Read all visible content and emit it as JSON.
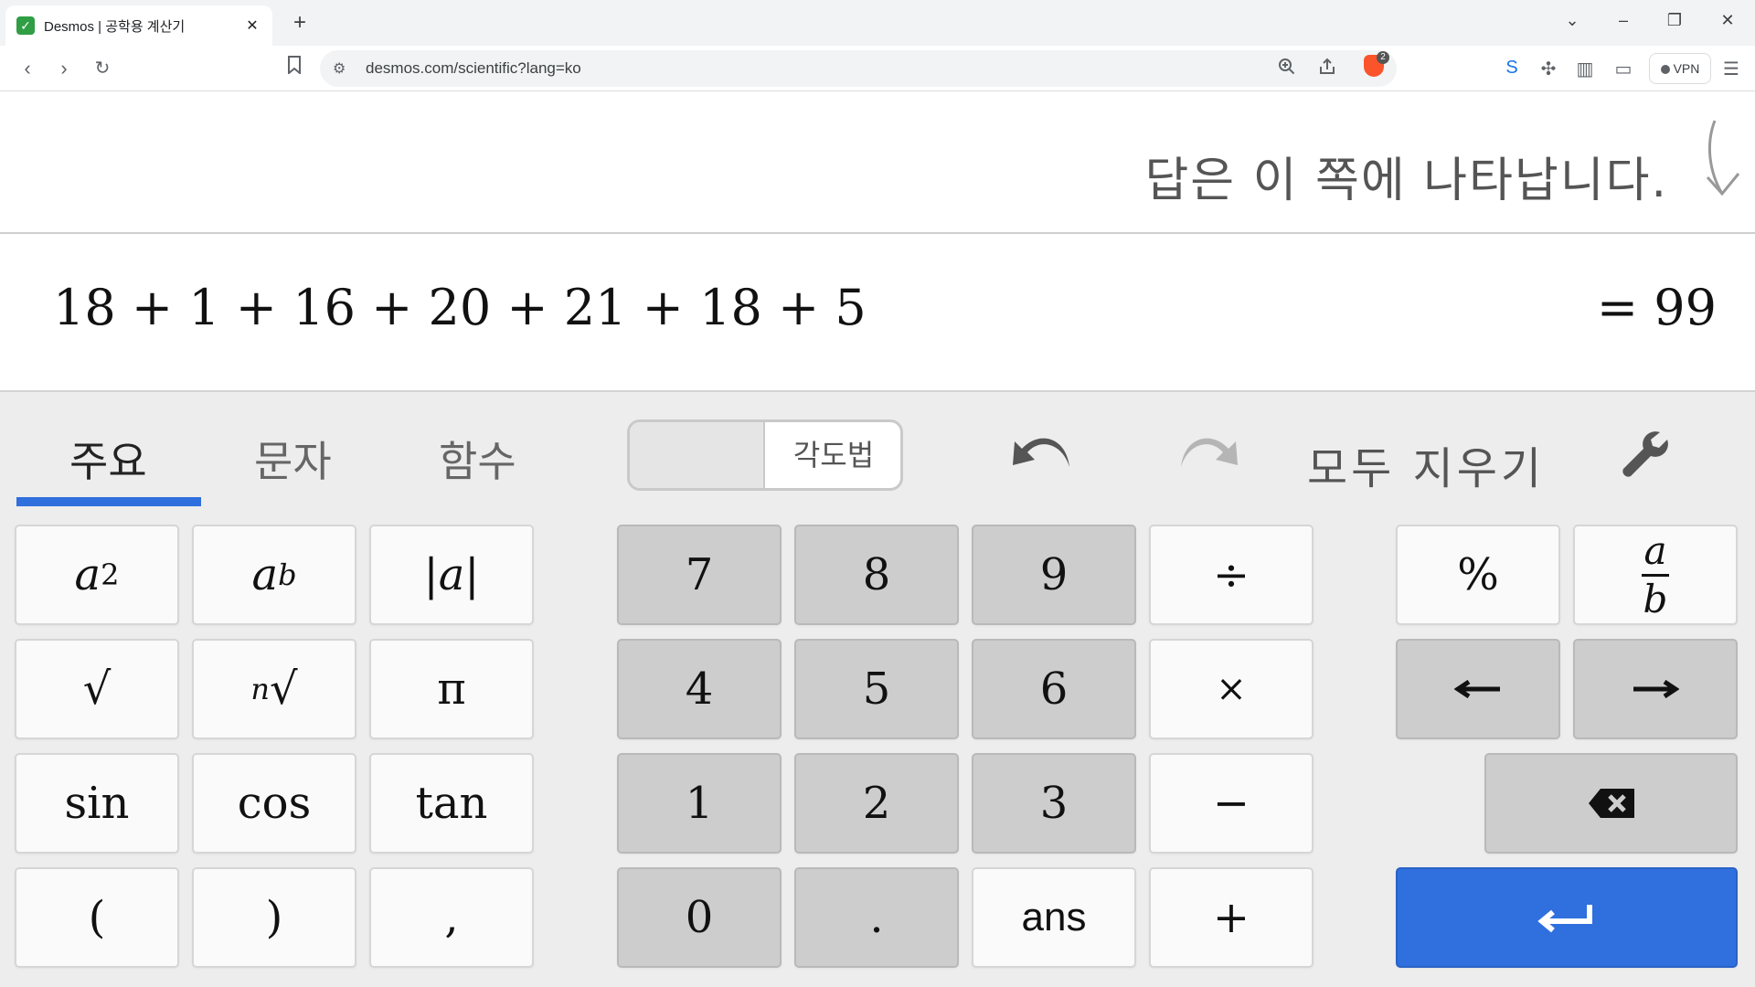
{
  "browser": {
    "tab_title": "Desmos | 공학용 계산기",
    "favicon": "✓",
    "url": "desmos.com/scientific?lang=ko",
    "brave_badge_count": "2",
    "vpn_label": "VPN"
  },
  "display": {
    "answer_hint": "답은 이 쪽에 나타납니다.",
    "expression": "18 + 1 + 16 + 20 + 21 + 18 + 5",
    "result": "= 99"
  },
  "keypad": {
    "tabs": [
      "주요",
      "문자",
      "함수"
    ],
    "active_tab": "주요",
    "angle_mode_label": "각도법",
    "clear_all_label": "모두 지우기",
    "functions": {
      "row1": {
        "square_base": "a",
        "square_exp": "2",
        "power_base": "a",
        "power_exp": "b",
        "abs": "|a|"
      },
      "row2": {
        "sqrt": "√",
        "nthroot_index": "n",
        "nthroot": "√",
        "pi": "π"
      },
      "row3": {
        "sin": "sin",
        "cos": "cos",
        "tan": "tan"
      },
      "row4": {
        "lparen": "(",
        "rparen": ")",
        "comma": ","
      }
    },
    "digits": {
      "row1": [
        "7",
        "8",
        "9"
      ],
      "row2": [
        "4",
        "5",
        "6"
      ],
      "row3": [
        "1",
        "2",
        "3"
      ],
      "row4": [
        "0",
        ".",
        "ans"
      ]
    },
    "operators": [
      "÷",
      "×",
      "−",
      "+"
    ],
    "extras": {
      "percent": "%",
      "frac_num": "a",
      "frac_den": "b",
      "left_arrow": "⟵",
      "right_arrow": "⟶"
    }
  },
  "colors": {
    "accent": "#2f6fde",
    "gray_key": "#cdcdcd",
    "keypad_bg": "#ededed"
  }
}
